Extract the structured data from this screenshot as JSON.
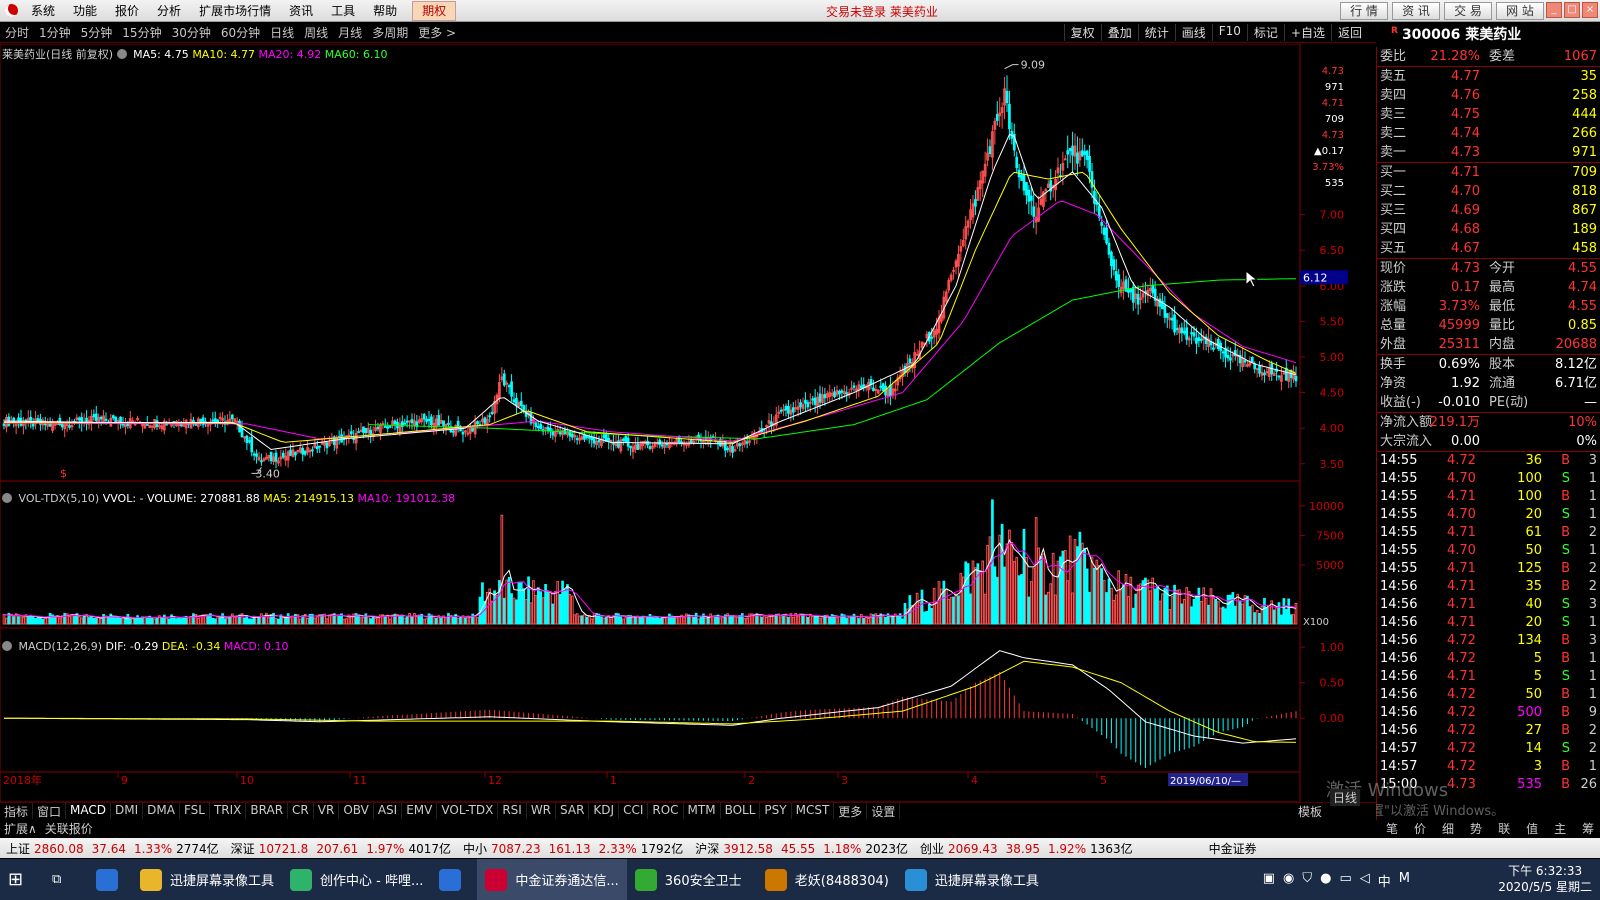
{
  "menubar": {
    "items": [
      "系统",
      "功能",
      "报价",
      "分析",
      "扩展市场行情",
      "资讯",
      "工具",
      "帮助"
    ],
    "highlight": "期权",
    "center_text": "交易未登录  莱美药业",
    "buttons": [
      "行 情",
      "资 讯",
      "交 易",
      "网 站"
    ]
  },
  "periods": [
    "分时",
    "1分钟",
    "5分钟",
    "15分钟",
    "30分钟",
    "60分钟",
    "日线",
    "周线",
    "月线",
    "多周期",
    "更多 >"
  ],
  "chart_tools": [
    "复权",
    "叠加",
    "统计",
    "画线",
    "F10",
    "标记",
    "+自选",
    "返回"
  ],
  "stock": {
    "code": "300006",
    "name": "莱美药业",
    "flag": "R"
  },
  "main_legend": {
    "title": "莱美药业(日线 前复权)",
    "ma5": "MA5: 4.75",
    "ma10": "MA10: 4.77",
    "ma20": "MA20: 4.92",
    "ma60": "MA60: 6.10"
  },
  "vol_legend": {
    "title": "VOL-TDX(5,10)",
    "vvol": "VVOL: -",
    "volume": "VOLUME: 270881.88",
    "ma5": "MA5: 214915.13",
    "ma10": "MA10: 191012.38"
  },
  "macd_legend": {
    "title": "MACD(12,26,9)",
    "dif": "DIF: -0.29",
    "dea": "DEA: -0.34",
    "macd": "MACD: 0.10"
  },
  "colors": {
    "up": "#ff5050",
    "down": "#00ffff",
    "ma5": "#ffffff",
    "ma10": "#ffff00",
    "ma20": "#ff00ff",
    "ma60": "#00ff00"
  },
  "chart_data": [
    {
      "type": "candlestick",
      "title": "莱美药业(日线 前复权)",
      "yaxis_ticks": [
        "7.00",
        "6.50",
        "6.00",
        "5.50",
        "5.00",
        "4.50",
        "4.00",
        "3.50"
      ],
      "ylim": [
        3.3,
        9.2
      ],
      "price_labels": {
        "high": "9.09",
        "low": "3.40",
        "current_marker": "6.12"
      },
      "right_top_labels": [
        "4.73",
        "971",
        "4.71",
        "709",
        "4.73",
        "▲0.17",
        "3.73%",
        "535"
      ],
      "x_months": [
        "2018年",
        "9",
        "10",
        "11",
        "12",
        "1",
        "2",
        "3",
        "4",
        "5"
      ],
      "cursor_date": "2019/06/10/—",
      "close_path": [
        [
          0,
          4.1
        ],
        [
          20,
          4.05
        ],
        [
          40,
          4.12
        ],
        [
          60,
          4.08
        ],
        [
          80,
          4.1
        ],
        [
          95,
          4.1
        ],
        [
          105,
          3.55
        ],
        [
          115,
          3.6
        ],
        [
          130,
          3.75
        ],
        [
          145,
          3.9
        ],
        [
          160,
          4.05
        ],
        [
          175,
          4.1
        ],
        [
          190,
          3.95
        ],
        [
          200,
          4.15
        ],
        [
          205,
          4.7
        ],
        [
          210,
          4.4
        ],
        [
          220,
          4.0
        ],
        [
          240,
          3.85
        ],
        [
          260,
          3.75
        ],
        [
          275,
          3.8
        ],
        [
          290,
          3.85
        ],
        [
          300,
          3.7
        ],
        [
          310,
          3.9
        ],
        [
          320,
          4.2
        ],
        [
          330,
          4.3
        ],
        [
          340,
          4.45
        ],
        [
          355,
          4.6
        ],
        [
          365,
          4.5
        ],
        [
          375,
          5.0
        ],
        [
          385,
          5.5
        ],
        [
          392,
          6.4
        ],
        [
          400,
          7.2
        ],
        [
          407,
          8.1
        ],
        [
          412,
          8.7
        ],
        [
          417,
          7.6
        ],
        [
          425,
          7.0
        ],
        [
          432,
          7.5
        ],
        [
          440,
          7.9
        ],
        [
          446,
          7.7
        ],
        [
          452,
          6.8
        ],
        [
          458,
          6.1
        ],
        [
          465,
          5.8
        ],
        [
          472,
          5.9
        ],
        [
          478,
          5.6
        ],
        [
          485,
          5.3
        ],
        [
          495,
          5.2
        ],
        [
          505,
          5.0
        ],
        [
          515,
          4.85
        ],
        [
          525,
          4.75
        ],
        [
          532,
          4.73
        ]
      ],
      "ma5": [
        [
          0,
          4.1
        ],
        [
          40,
          4.08
        ],
        [
          95,
          4.08
        ],
        [
          110,
          3.7
        ],
        [
          140,
          3.85
        ],
        [
          190,
          4.0
        ],
        [
          205,
          4.45
        ],
        [
          220,
          4.1
        ],
        [
          250,
          3.8
        ],
        [
          300,
          3.78
        ],
        [
          320,
          4.1
        ],
        [
          350,
          4.5
        ],
        [
          375,
          4.9
        ],
        [
          392,
          6.0
        ],
        [
          407,
          7.6
        ],
        [
          415,
          8.2
        ],
        [
          425,
          7.2
        ],
        [
          440,
          7.6
        ],
        [
          452,
          7.1
        ],
        [
          465,
          6.0
        ],
        [
          480,
          5.7
        ],
        [
          495,
          5.25
        ],
        [
          515,
          4.9
        ],
        [
          532,
          4.75
        ]
      ],
      "ma10": [
        [
          0,
          4.08
        ],
        [
          95,
          4.07
        ],
        [
          115,
          3.8
        ],
        [
          150,
          3.9
        ],
        [
          200,
          4.05
        ],
        [
          215,
          4.25
        ],
        [
          240,
          3.95
        ],
        [
          300,
          3.8
        ],
        [
          330,
          4.1
        ],
        [
          360,
          4.45
        ],
        [
          385,
          5.2
        ],
        [
          400,
          6.5
        ],
        [
          415,
          7.6
        ],
        [
          430,
          7.5
        ],
        [
          445,
          7.6
        ],
        [
          460,
          6.8
        ],
        [
          480,
          5.9
        ],
        [
          500,
          5.3
        ],
        [
          520,
          4.95
        ],
        [
          532,
          4.77
        ]
      ],
      "ma20": [
        [
          0,
          4.07
        ],
        [
          100,
          4.06
        ],
        [
          130,
          3.85
        ],
        [
          170,
          3.95
        ],
        [
          220,
          4.1
        ],
        [
          250,
          3.95
        ],
        [
          300,
          3.82
        ],
        [
          340,
          4.2
        ],
        [
          370,
          4.5
        ],
        [
          395,
          5.5
        ],
        [
          415,
          6.7
        ],
        [
          435,
          7.2
        ],
        [
          450,
          7.0
        ],
        [
          470,
          6.3
        ],
        [
          490,
          5.6
        ],
        [
          510,
          5.15
        ],
        [
          532,
          4.92
        ]
      ],
      "ma60": [
        [
          150,
          4.05
        ],
        [
          200,
          4.0
        ],
        [
          260,
          3.9
        ],
        [
          310,
          3.85
        ],
        [
          350,
          4.05
        ],
        [
          380,
          4.4
        ],
        [
          410,
          5.2
        ],
        [
          440,
          5.8
        ],
        [
          470,
          6.0
        ],
        [
          500,
          6.08
        ],
        [
          532,
          6.1
        ]
      ]
    },
    {
      "type": "bar",
      "title": "VOL-TDX(5,10)",
      "yaxis_ticks": [
        "10000",
        "7500",
        "5000"
      ],
      "unit": "X100",
      "ylim": [
        0,
        11000
      ],
      "spikes": [
        [
          205,
          9200
        ],
        [
          407,
          10500
        ],
        [
          425,
          9000
        ],
        [
          420,
          8000
        ]
      ]
    },
    {
      "type": "line",
      "title": "MACD(12,26,9)",
      "yaxis_ticks": [
        "1.00",
        "0.50",
        "0.00"
      ],
      "ylim": [
        -0.7,
        1.1
      ],
      "dif": [
        [
          0,
          0
        ],
        [
          100,
          -0.02
        ],
        [
          130,
          -0.05
        ],
        [
          200,
          0.02
        ],
        [
          250,
          -0.05
        ],
        [
          300,
          -0.1
        ],
        [
          320,
          0.0
        ],
        [
          360,
          0.15
        ],
        [
          390,
          0.45
        ],
        [
          410,
          0.95
        ],
        [
          420,
          0.85
        ],
        [
          440,
          0.75
        ],
        [
          455,
          0.4
        ],
        [
          470,
          -0.05
        ],
        [
          490,
          -0.25
        ],
        [
          510,
          -0.35
        ],
        [
          532,
          -0.29
        ]
      ],
      "dea": [
        [
          0,
          0
        ],
        [
          100,
          -0.01
        ],
        [
          150,
          -0.04
        ],
        [
          250,
          -0.04
        ],
        [
          300,
          -0.08
        ],
        [
          330,
          -0.02
        ],
        [
          370,
          0.1
        ],
        [
          400,
          0.45
        ],
        [
          420,
          0.8
        ],
        [
          440,
          0.72
        ],
        [
          460,
          0.5
        ],
        [
          480,
          0.1
        ],
        [
          500,
          -0.2
        ],
        [
          515,
          -0.33
        ],
        [
          532,
          -0.34
        ]
      ]
    }
  ],
  "quote_panel": {
    "weibi": {
      "label": "委比",
      "value": "21.28%",
      "label2": "委差",
      "value2": "1067"
    },
    "asks": [
      {
        "label": "卖五",
        "price": "4.77",
        "vol": "35"
      },
      {
        "label": "卖四",
        "price": "4.76",
        "vol": "258"
      },
      {
        "label": "卖三",
        "price": "4.75",
        "vol": "444"
      },
      {
        "label": "卖二",
        "price": "4.74",
        "vol": "266"
      },
      {
        "label": "卖一",
        "price": "4.73",
        "vol": "971"
      }
    ],
    "bids": [
      {
        "label": "买一",
        "price": "4.71",
        "vol": "709"
      },
      {
        "label": "买二",
        "price": "4.70",
        "vol": "818"
      },
      {
        "label": "买三",
        "price": "4.69",
        "vol": "867"
      },
      {
        "label": "买四",
        "price": "4.68",
        "vol": "189"
      },
      {
        "label": "买五",
        "price": "4.67",
        "vol": "458"
      }
    ],
    "stats1": [
      {
        "a": "现价",
        "b": "4.73",
        "c": "今开",
        "d": "4.55"
      },
      {
        "a": "涨跌",
        "b": "0.17",
        "c": "最高",
        "d": "4.74"
      },
      {
        "a": "涨幅",
        "b": "3.73%",
        "c": "最低",
        "d": "4.55"
      },
      {
        "a": "总量",
        "b": "45999",
        "c": "量比",
        "d": "0.85"
      },
      {
        "a": "外盘",
        "b": "25311",
        "c": "内盘",
        "d": "20688"
      }
    ],
    "stats2": [
      {
        "a": "换手",
        "b": "0.69%",
        "c": "股本",
        "d": "8.12亿"
      },
      {
        "a": "净资",
        "b": "1.92",
        "c": "流通",
        "d": "6.71亿"
      },
      {
        "a": "收益(-)",
        "b": "-0.010",
        "c": "PE(动)",
        "d": "—"
      }
    ],
    "flows": [
      {
        "a": "净流入额",
        "b": "219.1万",
        "d": "10%"
      },
      {
        "a": "大宗流入",
        "b": "0.00",
        "d": "0%"
      }
    ],
    "ticks": [
      [
        "14:55",
        "4.72",
        "36",
        "B",
        "3"
      ],
      [
        "14:55",
        "4.70",
        "100",
        "S",
        "1"
      ],
      [
        "14:55",
        "4.71",
        "100",
        "B",
        "1"
      ],
      [
        "14:55",
        "4.70",
        "20",
        "S",
        "1"
      ],
      [
        "14:55",
        "4.71",
        "61",
        "B",
        "2"
      ],
      [
        "14:55",
        "4.70",
        "50",
        "S",
        "1"
      ],
      [
        "14:55",
        "4.71",
        "125",
        "B",
        "2"
      ],
      [
        "14:56",
        "4.71",
        "35",
        "B",
        "2"
      ],
      [
        "14:56",
        "4.71",
        "40",
        "S",
        "3"
      ],
      [
        "14:56",
        "4.71",
        "20",
        "S",
        "1"
      ],
      [
        "14:56",
        "4.72",
        "134",
        "B",
        "3"
      ],
      [
        "14:56",
        "4.72",
        "5",
        "B",
        "1"
      ],
      [
        "14:56",
        "4.71",
        "5",
        "S",
        "1"
      ],
      [
        "14:56",
        "4.72",
        "50",
        "B",
        "1"
      ],
      [
        "14:56",
        "4.72",
        "500",
        "B",
        "9"
      ],
      [
        "14:56",
        "4.72",
        "27",
        "B",
        "2"
      ],
      [
        "14:57",
        "4.72",
        "14",
        "S",
        "2"
      ],
      [
        "14:57",
        "4.72",
        "3",
        "B",
        "1"
      ],
      [
        "15:00",
        "4.73",
        "535",
        "B",
        "26"
      ]
    ],
    "bottom_tabs": [
      "笔",
      "价",
      "细",
      "势",
      "联",
      "值",
      "主",
      "筹"
    ]
  },
  "indicator_tabs": [
    "指标",
    "窗口",
    "MACD",
    "DMI",
    "DMA",
    "FSL",
    "TRIX",
    "BRAR",
    "CR",
    "VR",
    "OBV",
    "ASI",
    "EMV",
    "VOL-TDX",
    "RSI",
    "WR",
    "SAR",
    "KDJ",
    "CCI",
    "ROC",
    "MTM",
    "BOLL",
    "PSY",
    "MCST",
    "更多",
    "设置"
  ],
  "mode_label": "模板",
  "rilabel": "日线",
  "extra_tabs": [
    "扩展∧",
    "关联报价"
  ],
  "status": {
    "indices": [
      {
        "name": "上证",
        "val": "2860.08",
        "chg": "37.64",
        "pct": "1.33%",
        "amt": "2774亿"
      },
      {
        "name": "深证",
        "val": "10721.8",
        "chg": "207.61",
        "pct": "1.97%",
        "amt": "4017亿"
      },
      {
        "name": "中小",
        "val": "7087.23",
        "chg": "161.13",
        "pct": "2.33%",
        "amt": "1792亿"
      },
      {
        "name": "沪深",
        "val": "3912.58",
        "chg": "45.55",
        "pct": "1.18%",
        "amt": "2023亿"
      },
      {
        "name": "创业",
        "val": "2069.43",
        "chg": "38.95",
        "pct": "1.92%",
        "amt": "1363亿"
      }
    ],
    "broker": "中金证券"
  },
  "taskbar": {
    "apps": [
      "迅捷屏幕录像工具",
      "创作中心 - 哔哩...",
      "",
      "中金证券通达信...",
      "360安全卫士",
      "老妖(8488304)",
      "迅捷屏幕录像工具"
    ],
    "ime": "中",
    "time": "下午 6:32:33",
    "date": "2020/5/5 星期二"
  },
  "watermark": {
    "line1": "激活 Windows",
    "line2": "转到\"设置\"以激活 Windows。"
  }
}
